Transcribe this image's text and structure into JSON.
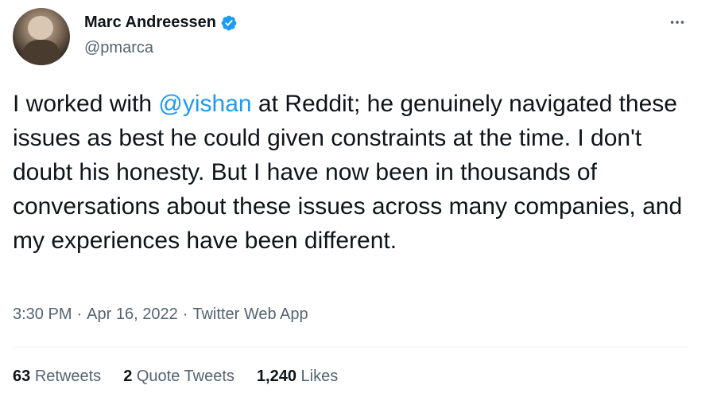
{
  "author": {
    "display_name": "Marc Andreessen",
    "handle": "@pmarca",
    "verified": true,
    "verified_color": "#1d9bf0"
  },
  "tweet": {
    "text_before": "I worked with ",
    "mention": "@yishan",
    "text_after": " at Reddit; he genuinely navigated these issues as best he could given constraints at the time. I don't doubt his honesty. But I have now been in thousands of conversations about these issues across many companies, and my experiences have been different.",
    "time": "3:30 PM",
    "separator": "·",
    "date": "Apr 16, 2022",
    "source": "Twitter Web App"
  },
  "stats": {
    "retweets_count": "63",
    "retweets_label": "Retweets",
    "quote_count": "2",
    "quote_label": "Quote Tweets",
    "likes_count": "1,240",
    "likes_label": "Likes"
  },
  "colors": {
    "text": "#0f1419",
    "secondary": "#536471",
    "accent": "#1d9bf0"
  }
}
